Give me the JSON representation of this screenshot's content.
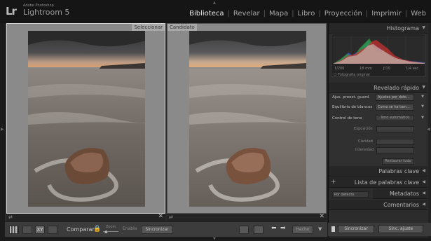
{
  "app": {
    "logo_mark": "Lr",
    "logo_small": "Adobe Photoshop",
    "logo_name": "Lightroom 5"
  },
  "modules": [
    {
      "label": "Biblioteca",
      "active": true
    },
    {
      "label": "Revelar",
      "active": false
    },
    {
      "label": "Mapa",
      "active": false
    },
    {
      "label": "Libro",
      "active": false
    },
    {
      "label": "Proyección",
      "active": false
    },
    {
      "label": "Imprimir",
      "active": false
    },
    {
      "label": "Web",
      "active": false
    }
  ],
  "compare": {
    "select_label": "Seleccionar",
    "candidate_label": "Candidato",
    "lock_glyph": "⇄",
    "close_glyph": "✕"
  },
  "toolbar": {
    "compare_label": "Comparar:",
    "zoom_label": "Zoom",
    "enable_label": "Enable",
    "sync_label": "Sincronizar",
    "done_label": "Hecho",
    "xy_label": "XY"
  },
  "right_panel": {
    "histogram_title": "Histograma",
    "histo_values": [
      "1/200",
      "18 mm",
      "ƒ/10",
      "1/4 sec"
    ],
    "original_photo": "Fotografía original",
    "quick_develop_title": "Revelado rápido",
    "qd_rows": [
      {
        "label": "Ajus. preest. guard.",
        "value": "Ajustes por defe..."
      },
      {
        "label": "Equilibrio de blancos",
        "value": "Como se ha tom..."
      }
    ],
    "tone_control_label": "Control de tono",
    "tone_auto": "Tono automático",
    "exposure_label": "Exposición",
    "clarity_label": "Claridad",
    "vibrance_label": "Intensidad",
    "reset_all": "Restaurar todo",
    "keywords_title": "Palabras clave",
    "keyword_list_title": "Lista de palabras clave",
    "default_label": "Por defecto",
    "metadata_title": "Metadatos",
    "comments_title": "Comentarios"
  },
  "bottom_buttons": {
    "sync_meta": "Sincronizar",
    "sync_settings": "Sinc. ajuste"
  },
  "colors": {
    "accent_active": "#ececec",
    "panel_bg": "#2c2c2c",
    "lock_gold": "#d8b84a"
  }
}
